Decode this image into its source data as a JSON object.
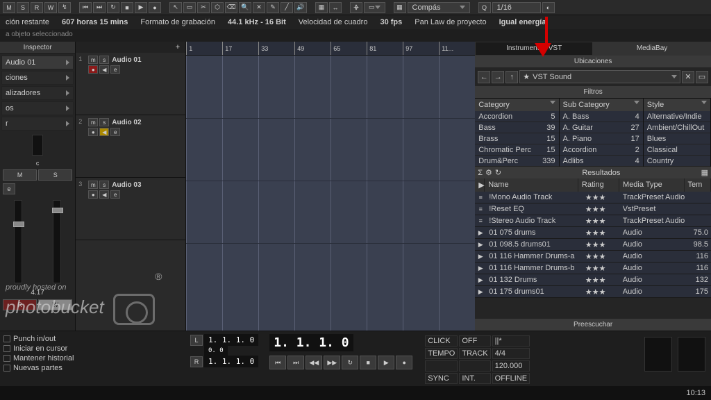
{
  "toolbar": {
    "btns1": [
      "M",
      "S",
      "R",
      "W"
    ],
    "compas": "Compás",
    "q": "Q",
    "qval": "1/16"
  },
  "status": {
    "remaining_lbl": "ción restante",
    "remaining_val": "607 horas 15 mins",
    "rec_format_lbl": "Formato de grabación",
    "rec_format_val": "44.1 kHz - 16 Bit",
    "frame_lbl": "Velocidad de cuadro",
    "frame_val": "30 fps",
    "pan_lbl": "Pan Law de proyecto",
    "pan_val": "Igual energía"
  },
  "objbar": "a objeto seleccionado",
  "inspector": {
    "title": "Inspector",
    "track": "Audio 01",
    "sections": [
      "ciones",
      "alizadores",
      "os",
      "r"
    ],
    "c_label": "c",
    "m": "M",
    "s": "S",
    "e": "e",
    "val": "4.17",
    "r": "R",
    "w": "W"
  },
  "tracks": [
    {
      "num": "1",
      "name": "Audio 01",
      "rec": true,
      "spk": "norm"
    },
    {
      "num": "2",
      "name": "Audio 02",
      "rec": false,
      "spk": "ylw"
    },
    {
      "num": "3",
      "name": "Audio 03",
      "rec": false,
      "spk": "norm"
    }
  ],
  "ruler": [
    "1",
    "17",
    "33",
    "49",
    "65",
    "81",
    "97",
    "11..."
  ],
  "right_tabs": {
    "inst": "Instrumentos VST",
    "media": "MediaBay"
  },
  "mediabay": {
    "ubicaciones": "Ubicaciones",
    "star": "★",
    "vst": "VST Sound",
    "filtros": "Filtros",
    "cat_hdr": "Category",
    "sub_hdr": "Sub Category",
    "style_hdr": "Style",
    "cat": [
      [
        "Accordion",
        "5"
      ],
      [
        "Bass",
        "39"
      ],
      [
        "Brass",
        "15"
      ],
      [
        "Chromatic Perc",
        "15"
      ],
      [
        "Drum&Perc",
        "339"
      ]
    ],
    "sub": [
      [
        "A. Bass",
        "4"
      ],
      [
        "A. Guitar",
        "27"
      ],
      [
        "A. Piano",
        "17"
      ],
      [
        "Accordion",
        "2"
      ],
      [
        "Adlibs",
        "4"
      ]
    ],
    "style": [
      "Alternative/Indie",
      "Ambient/ChillOut",
      "Blues",
      "Classical",
      "Country"
    ],
    "resultados": "Resultados",
    "cols": {
      "name": "Name",
      "rating": "Rating",
      "media": "Media Type",
      "tem": "Tem"
    },
    "rows": [
      {
        "icon": "≡",
        "name": "!Mono Audio Track",
        "rating": "★★★",
        "media": "TrackPreset Audio",
        "t": ""
      },
      {
        "icon": "≡",
        "name": "!Reset EQ",
        "rating": "★★★",
        "media": "VstPreset",
        "t": ""
      },
      {
        "icon": "≡",
        "name": "!Stereo Audio Track",
        "rating": "★★★",
        "media": "TrackPreset Audio",
        "t": ""
      },
      {
        "icon": "▶",
        "name": "01 075 drums",
        "rating": "★★★",
        "media": "Audio",
        "t": "75.0"
      },
      {
        "icon": "▶",
        "name": "01 098.5 drums01",
        "rating": "★★★",
        "media": "Audio",
        "t": "98.5"
      },
      {
        "icon": "▶",
        "name": "01 116 Hammer Drums-a",
        "rating": "★★★",
        "media": "Audio",
        "t": "116"
      },
      {
        "icon": "▶",
        "name": "01 116 Hammer Drums-b",
        "rating": "★★★",
        "media": "Audio",
        "t": "116"
      },
      {
        "icon": "▶",
        "name": "01 132 Drums",
        "rating": "★★★",
        "media": "Audio",
        "t": "132"
      },
      {
        "icon": "▶",
        "name": "01 175 drums01",
        "rating": "★★★",
        "media": "Audio",
        "t": "175"
      }
    ],
    "preescuchar": "Preescuchar"
  },
  "transport": {
    "punch": "Punch in/out",
    "cursor": "Iniciar en cursor",
    "hist": "Mantener historial",
    "nuevas": "Nuevas partes",
    "l": "L",
    "r": "R",
    "t1": "1.  1.  1.   0",
    "t2": "0.   0",
    "big": "1.  1.  1.   0",
    "click": "CLICK",
    "off": "OFF",
    "tempo": "TEMPO",
    "track": "TRACK",
    "tval": "4/4",
    "tval2": "120.000",
    "sync": "SYNC",
    "int": "INT.",
    "offline": "OFFLINE"
  },
  "watermark": {
    "l1": "proudly hosted on",
    "l2": "photobucket"
  },
  "clock": "10:13"
}
